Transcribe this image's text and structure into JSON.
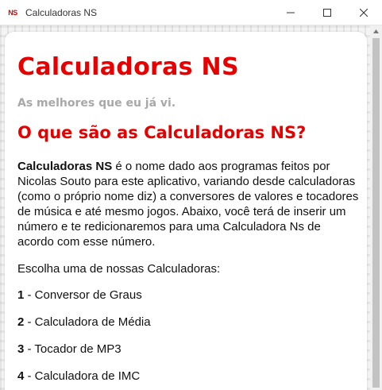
{
  "window": {
    "icon_text": "NS",
    "title": "Calculadoras NS"
  },
  "page": {
    "title": "Calculadoras NS",
    "subtitle": "As melhores que eu já vi.",
    "section_title": "O que são as Calculadoras NS?",
    "intro_bold": "Calculadoras NS",
    "intro_rest": " é o nome dado aos programas feitos por Nicolas Souto para este aplicativo, variando desde calculadoras (como o próprio nome diz) a conversores de valores e tocadores de música e até mesmo jogos. Abaixo, você terá de inserir um número e te redicionaremos para uma Calculadora Ns de acordo com esse número.",
    "choose_text": "Escolha uma de nossas Calculadoras:",
    "calculators": [
      {
        "number": "1",
        "label": " - Conversor de Graus"
      },
      {
        "number": "2",
        "label": " - Calculadora de Média"
      },
      {
        "number": "3",
        "label": " - Tocador de MP3"
      },
      {
        "number": "4",
        "label": " - Calculadora de IMC"
      }
    ]
  },
  "colors": {
    "accent": "#e60000",
    "subtitle": "#a8a8a8"
  },
  "icons": {
    "minimize": "minimize-icon",
    "maximize": "maximize-icon",
    "close": "close-icon"
  }
}
